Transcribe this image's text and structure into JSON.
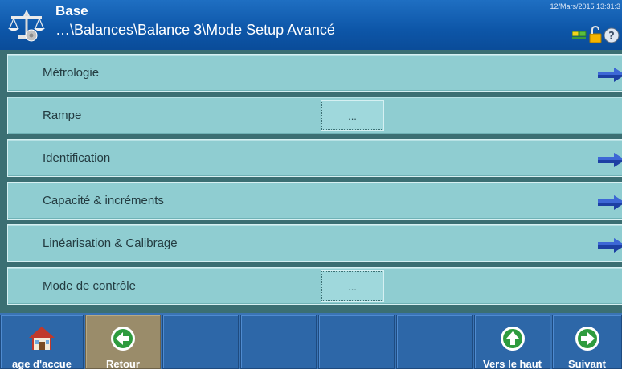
{
  "header": {
    "title": "Base",
    "path": "…\\Balances\\Balance 3\\Mode Setup Avancé",
    "datetime": "12/Mars/2015 13:31:3"
  },
  "menu": {
    "items": [
      {
        "label": "Métrologie",
        "control": "arrow-right-icon"
      },
      {
        "label": "Rampe",
        "control": "ellipsis",
        "button_text": "..."
      },
      {
        "label": "Identification",
        "control": "arrow-right-icon"
      },
      {
        "label": "Capacité & incréments",
        "control": "arrow-right-icon"
      },
      {
        "label": "Linéarisation & Calibrage",
        "control": "arrow-right-icon"
      },
      {
        "label": "Mode de contrôle",
        "control": "ellipsis",
        "button_text": "..."
      }
    ]
  },
  "softkeys": [
    {
      "label": "age d'accue",
      "icon": "home-icon"
    },
    {
      "label": "Retour",
      "icon": "back-arrow-icon"
    },
    {
      "label": "",
      "icon": ""
    },
    {
      "label": "",
      "icon": ""
    },
    {
      "label": "",
      "icon": ""
    },
    {
      "label": "",
      "icon": ""
    },
    {
      "label": "Vers le haut",
      "icon": "up-arrow-icon"
    },
    {
      "label": "Suivant",
      "icon": "next-arrow-icon"
    }
  ],
  "colors": {
    "header": "#0d56a8",
    "row": "#8fcdd1",
    "menu_background": "#3b6f73",
    "softkey": "#2d67a8",
    "softkey_back": "#9a8c6a",
    "arrow": "#1c3fa3"
  }
}
